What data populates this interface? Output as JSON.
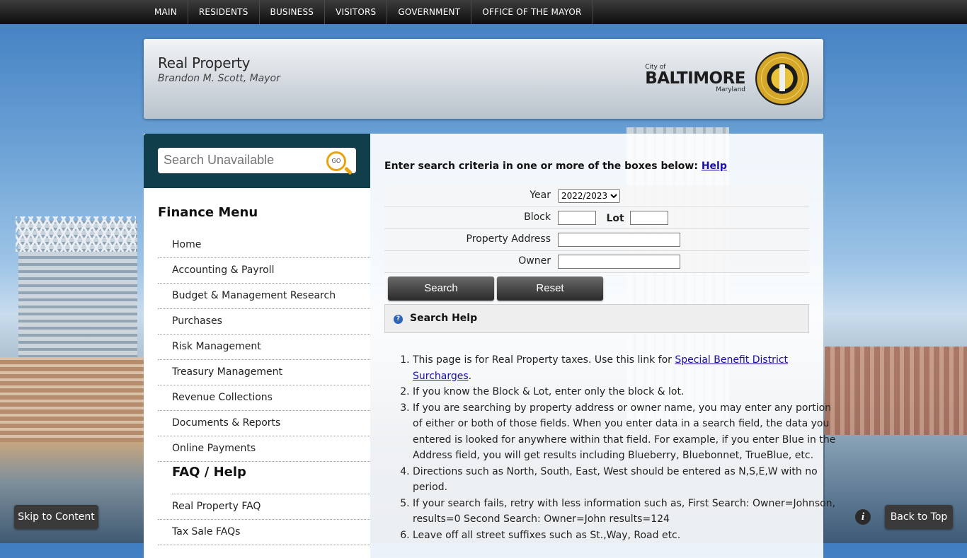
{
  "nav": [
    "MAIN",
    "RESIDENTS",
    "BUSINESS",
    "VISITORS",
    "GOVERNMENT",
    "OFFICE OF THE MAYOR"
  ],
  "header": {
    "title": "Real Property",
    "subtitle": "Brandon M. Scott, Mayor",
    "logo": {
      "city_of": "City of",
      "name": "BALTIMORE",
      "state": "Maryland"
    },
    "seal_text": "CITY OF BALTIMORE"
  },
  "sidebar": {
    "search_placeholder": "Search Unavailable",
    "go_label": "GO",
    "menu_title": "Finance Menu",
    "items": [
      "Home",
      "Accounting & Payroll",
      "Budget & Management Research",
      "Purchases",
      "Risk Management",
      "Treasury Management",
      "Revenue Collections",
      "Documents & Reports",
      "Online Payments"
    ],
    "faq_heading": "FAQ / Help",
    "faq_items": [
      "Real Property FAQ",
      "Tax Sale FAQs"
    ]
  },
  "form": {
    "instructions": "Enter search criteria in one or more of the boxes below:",
    "help_link": "Help",
    "year_label": "Year",
    "year_selected": "2022/2023",
    "block_label": "Block",
    "lot_label": "Lot",
    "address_label": "Property Address",
    "owner_label": "Owner",
    "search_button": "Search",
    "reset_button": "Reset"
  },
  "help": {
    "title": "Search Help",
    "item1_text": "This page is for Real Property taxes. Use this link for ",
    "item1_link": "Special Benefit District Surcharges",
    "item1_end": ".",
    "item2": "If you know the Block & Lot, enter only the block & lot.",
    "item3": "If you are searching by property address or owner name, you may enter any portion of either or both of those fields. When you enter data in a search field, the data you entered is looked for anywhere within that field. For example, if you enter Blue in the Address field, you will get results including Blueberry, Bluebonnet, TrueBlue, etc.",
    "item4": "Directions such as North, South, East, West should be entered as N,S,E,W with no period.",
    "item5": "If your search fails, retry with less information such as, First Search: Owner=Johnson, results=0 Second Search: Owner=John results=124",
    "item6": "Leave off all street suffixes such as St.,Way, Road etc."
  },
  "floating": {
    "skip": "Skip to Content",
    "back_to_top": "Back to Top",
    "info": "i"
  }
}
